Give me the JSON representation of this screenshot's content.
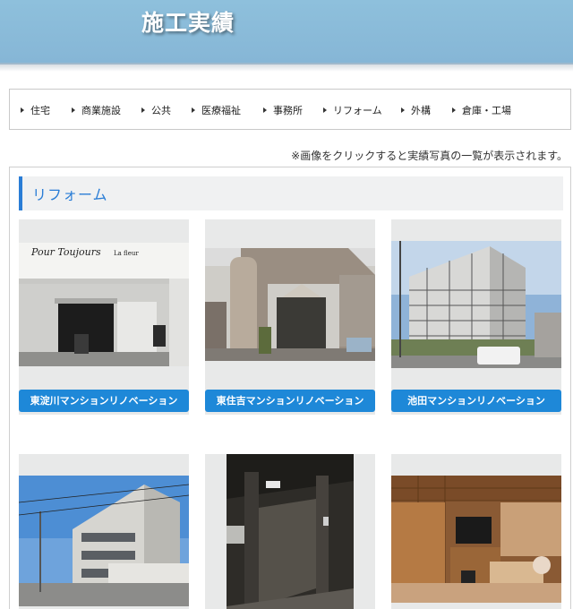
{
  "header": {
    "title": "施工実績"
  },
  "nav": {
    "items": [
      {
        "label": "住宅"
      },
      {
        "label": "商業施設"
      },
      {
        "label": "公共"
      },
      {
        "label": "医療福祉"
      },
      {
        "label": "事務所"
      },
      {
        "label": "リフォーム"
      },
      {
        "label": "外構"
      },
      {
        "label": "倉庫・工場"
      }
    ]
  },
  "notice": "※画像をクリックすると実績写真の一覧が表示されます。",
  "section": {
    "title": "リフォーム"
  },
  "cards": [
    {
      "label": "東淀川マンションリノベーション",
      "sign_text": "Pour Toujours",
      "sign_sub": "La fleur"
    },
    {
      "label": "東住吉マンションリノベーション"
    },
    {
      "label": "池田マンションリノベーション"
    },
    {
      "label": ""
    },
    {
      "label": ""
    },
    {
      "label": ""
    }
  ],
  "colors": {
    "header": "#8ec0dc",
    "accent": "#2a7dd6",
    "button": "#1e88d8"
  }
}
